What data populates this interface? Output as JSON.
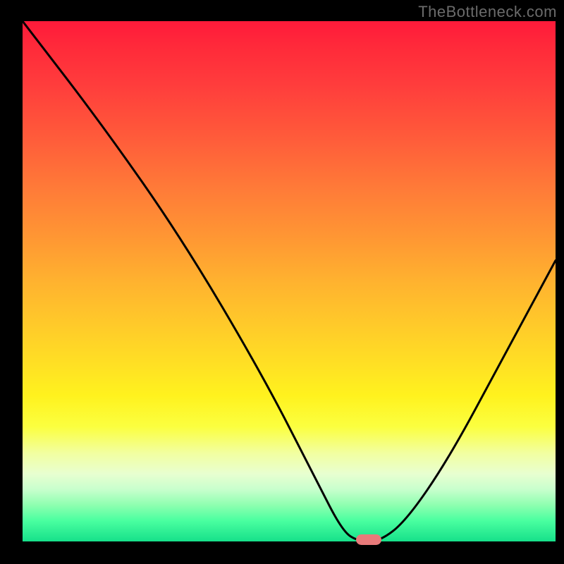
{
  "watermark": "TheBottleneck.com",
  "chart_data": {
    "type": "line",
    "title": "",
    "xlabel": "",
    "ylabel": "",
    "xlim": [
      0,
      100
    ],
    "ylim": [
      0,
      100
    ],
    "grid": false,
    "series": [
      {
        "name": "bottleneck-curve",
        "x": [
          0,
          15,
          30,
          45,
          55,
          60,
          63,
          67,
          72,
          80,
          90,
          100
        ],
        "values": [
          100,
          80,
          58,
          32,
          12,
          2,
          0,
          0,
          4,
          16,
          35,
          54
        ]
      }
    ],
    "annotations": [
      {
        "name": "optimal-marker",
        "x": 65,
        "y": 0
      }
    ],
    "background_gradient": {
      "direction": "vertical",
      "stops": [
        {
          "pos": 0,
          "color": "#ff1a3a"
        },
        {
          "pos": 50,
          "color": "#ffb22f"
        },
        {
          "pos": 78,
          "color": "#fbff40"
        },
        {
          "pos": 100,
          "color": "#16e08a"
        }
      ]
    }
  }
}
